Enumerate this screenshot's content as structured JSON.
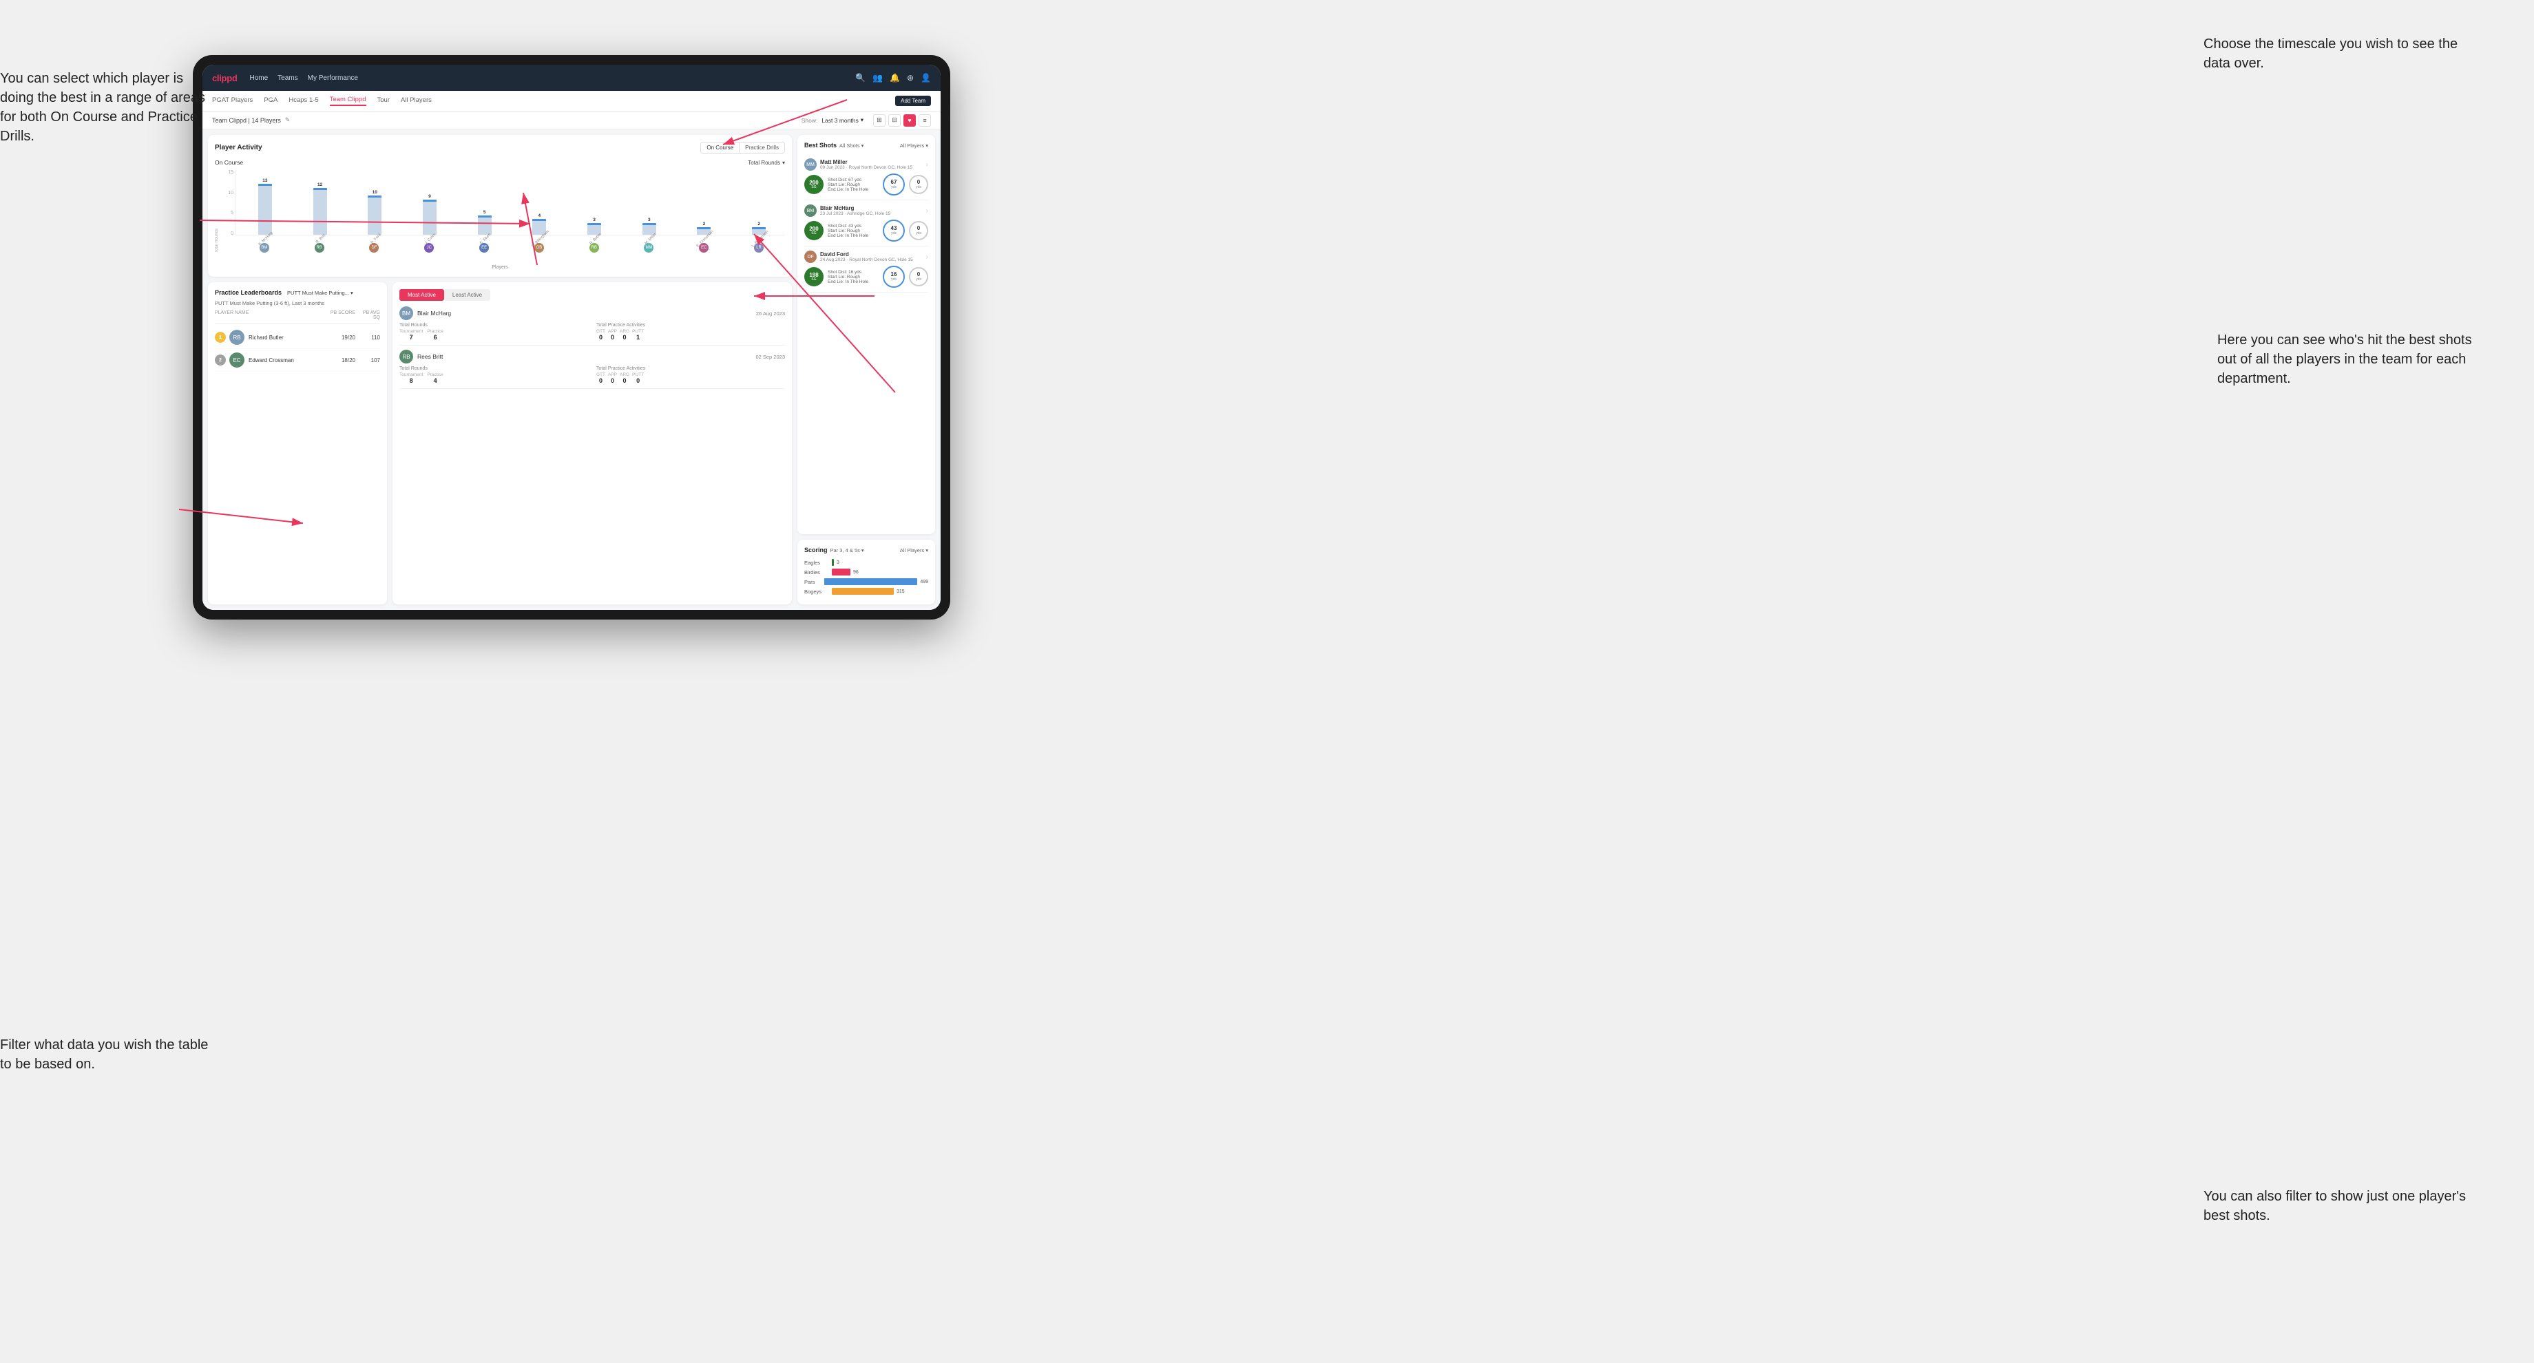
{
  "annotations": {
    "top_right": "Choose the timescale you\nwish to see the data over.",
    "top_left": "You can select which player is\ndoing the best in a range of\nareas for both On Course and\nPractice Drills.",
    "bottom_left": "Filter what data you wish the\ntable to be based on.",
    "bottom_right_top": "Here you can see who's hit\nthe best shots out of all the\nplayers in the team for\neach department.",
    "bottom_right_bottom": "You can also filter to show\njust one player's best shots."
  },
  "nav": {
    "brand": "clippd",
    "links": [
      "Home",
      "Teams",
      "My Performance"
    ],
    "icons": [
      "search",
      "users",
      "bell",
      "plus",
      "user"
    ]
  },
  "sub_nav": {
    "tabs": [
      "PGAT Players",
      "PGA",
      "Hcaps 1-5",
      "Team Clippd",
      "Tour",
      "All Players"
    ],
    "active_tab": "Team Clippd",
    "action_label": "Add Team"
  },
  "team_header": {
    "title": "Team Clippd | 14 Players",
    "show_label": "Show:",
    "time_filter": "Last 3 months",
    "view_options": [
      "grid",
      "card",
      "heart",
      "list"
    ]
  },
  "player_activity": {
    "title": "Player Activity",
    "toggle_options": [
      "On Course",
      "Practice Drills"
    ],
    "active_toggle": "On Course",
    "sub_label": "On Course",
    "metric_select": "Total Rounds",
    "y_axis_labels": [
      "15",
      "10",
      "5",
      "0"
    ],
    "y_title": "Total Rounds",
    "bars": [
      {
        "name": "B. McHarg",
        "value": 13,
        "height_pct": 87
      },
      {
        "name": "R. Britt",
        "value": 12,
        "height_pct": 80
      },
      {
        "name": "D. Ford",
        "value": 10,
        "height_pct": 67
      },
      {
        "name": "J. Coles",
        "value": 9,
        "height_pct": 60
      },
      {
        "name": "E. Ebert",
        "value": 5,
        "height_pct": 33
      },
      {
        "name": "G. Billingham",
        "value": 4,
        "height_pct": 27
      },
      {
        "name": "R. Butler",
        "value": 3,
        "height_pct": 20
      },
      {
        "name": "M. Miller",
        "value": 3,
        "height_pct": 20
      },
      {
        "name": "E. Crossman",
        "value": 2,
        "height_pct": 13
      },
      {
        "name": "L. Robertson",
        "value": 2,
        "height_pct": 13
      }
    ],
    "x_label": "Players"
  },
  "practice_leaderboards": {
    "title": "Practice Leaderboards",
    "filter": "PUTT Must Make Putting...",
    "subtitle": "PUTT Must Make Putting (3-6 ft), Last 3 months",
    "columns": [
      "PLAYER NAME",
      "PB SCORE",
      "PB AVG SQ"
    ],
    "players": [
      {
        "rank": 1,
        "name": "Richard Butler",
        "score": "19/20",
        "avg": "110",
        "rank_color": "gold"
      },
      {
        "rank": 2,
        "name": "Edward Crossman",
        "score": "18/20",
        "avg": "107",
        "rank_color": "silver"
      }
    ]
  },
  "most_active": {
    "toggle_options": [
      "Most Active",
      "Least Active"
    ],
    "active_toggle": "Most Active",
    "players": [
      {
        "name": "Blair McHarg",
        "date": "26 Aug 2023",
        "total_rounds_label": "Total Rounds",
        "tournament": "7",
        "practice": "6",
        "total_practice_label": "Total Practice Activities",
        "gtt": "0",
        "app": "0",
        "arg": "0",
        "putt": "1"
      },
      {
        "name": "Rees Britt",
        "date": "02 Sep 2023",
        "total_rounds_label": "Total Rounds",
        "tournament": "8",
        "practice": "4",
        "total_practice_label": "Total Practice Activities",
        "gtt": "0",
        "app": "0",
        "arg": "0",
        "putt": "0"
      }
    ]
  },
  "best_shots": {
    "title": "Best Shots",
    "filter": "All Shots",
    "player_filter": "All Players",
    "shots": [
      {
        "player": "Matt Miller",
        "date": "09 Jun 2023",
        "course": "Royal North Devon GC",
        "hole": "Hole 15",
        "badge_num": "200",
        "badge_label": "SG",
        "shot_dist": "Shot Dist: 67 yds",
        "start_lie": "Start Lie: Rough",
        "end_lie": "End Lie: In The Hole",
        "dist_val": "67",
        "dist_unit": "yds",
        "end_val": "0",
        "end_unit": "yds"
      },
      {
        "player": "Blair McHarg",
        "date": "23 Jul 2023",
        "course": "Ashridge GC",
        "hole": "Hole 15",
        "badge_num": "200",
        "badge_label": "SG",
        "shot_dist": "Shot Dist: 43 yds",
        "start_lie": "Start Lie: Rough",
        "end_lie": "End Lie: In The Hole",
        "dist_val": "43",
        "dist_unit": "yds",
        "end_val": "0",
        "end_unit": "yds"
      },
      {
        "player": "David Ford",
        "date": "24 Aug 2023",
        "course": "Royal North Devon GC",
        "hole": "Hole 15",
        "badge_num": "198",
        "badge_label": "SG",
        "shot_dist": "Shot Dist: 16 yds",
        "start_lie": "Start Lie: Rough",
        "end_lie": "End Lie: In The Hole",
        "dist_val": "16",
        "dist_unit": "yds",
        "end_val": "0",
        "end_unit": "yds"
      }
    ]
  },
  "scoring": {
    "title": "Scoring",
    "filter": "Par 3, 4 & 5s",
    "player_filter": "All Players",
    "bars": [
      {
        "label": "Eagles",
        "value": 3,
        "color": "#2c7a2c",
        "width_pct": 2
      },
      {
        "label": "Birdies",
        "value": 96,
        "color": "#e8365d",
        "width_pct": 18
      },
      {
        "label": "Pars",
        "value": 499,
        "color": "#4a90d9",
        "width_pct": 90
      },
      {
        "label": "Bogeys",
        "value": 315,
        "color": "#f0a030",
        "width_pct": 60
      }
    ]
  }
}
